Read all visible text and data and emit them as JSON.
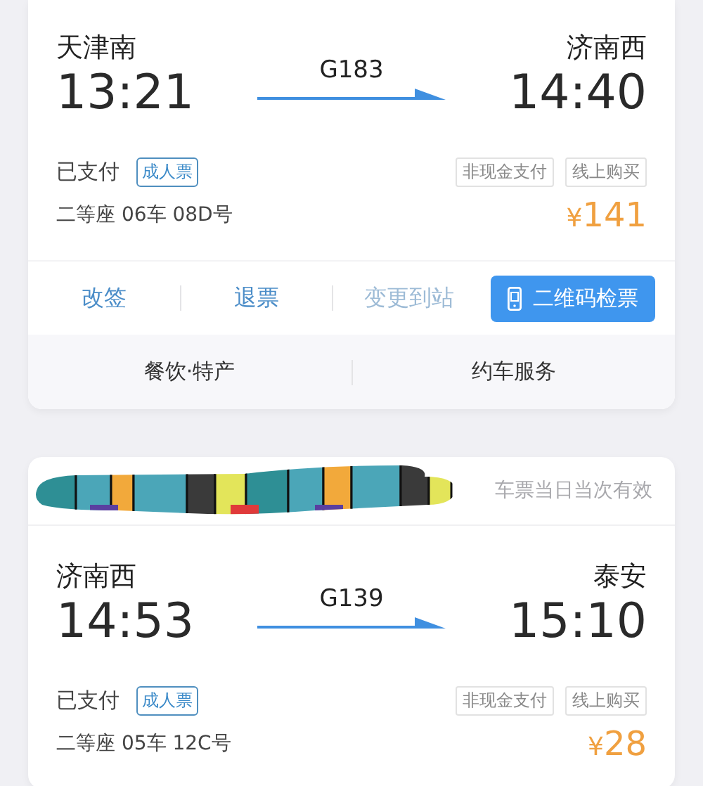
{
  "tickets": [
    {
      "departure": {
        "station": "天津南",
        "time": "13:21"
      },
      "train": "G183",
      "arrival": {
        "station": "济南西",
        "time": "14:40"
      },
      "status": "已支付",
      "ticket_type": "成人票",
      "tags": [
        "非现金支付",
        "线上购买"
      ],
      "seat": "二等座 06车 08D号",
      "currency": "¥",
      "price": "141",
      "actions": [
        {
          "label": "改签",
          "kind": "link",
          "disabled": false
        },
        {
          "label": "退票",
          "kind": "link",
          "disabled": false
        },
        {
          "label": "变更到站",
          "kind": "link",
          "disabled": true
        },
        {
          "label": "二维码检票",
          "kind": "primary",
          "disabled": false
        }
      ],
      "services": [
        "餐饮·特产",
        "约车服务"
      ]
    },
    {
      "header": {
        "redacted": true,
        "note": "车票当日当次有效"
      },
      "departure": {
        "station": "济南西",
        "time": "14:53"
      },
      "train": "G139",
      "arrival": {
        "station": "泰安",
        "time": "15:10"
      },
      "status": "已支付",
      "ticket_type": "成人票",
      "tags": [
        "非现金支付",
        "线上购买"
      ],
      "seat": "二等座 05车 12C号",
      "currency": "¥",
      "price": "28"
    }
  ]
}
